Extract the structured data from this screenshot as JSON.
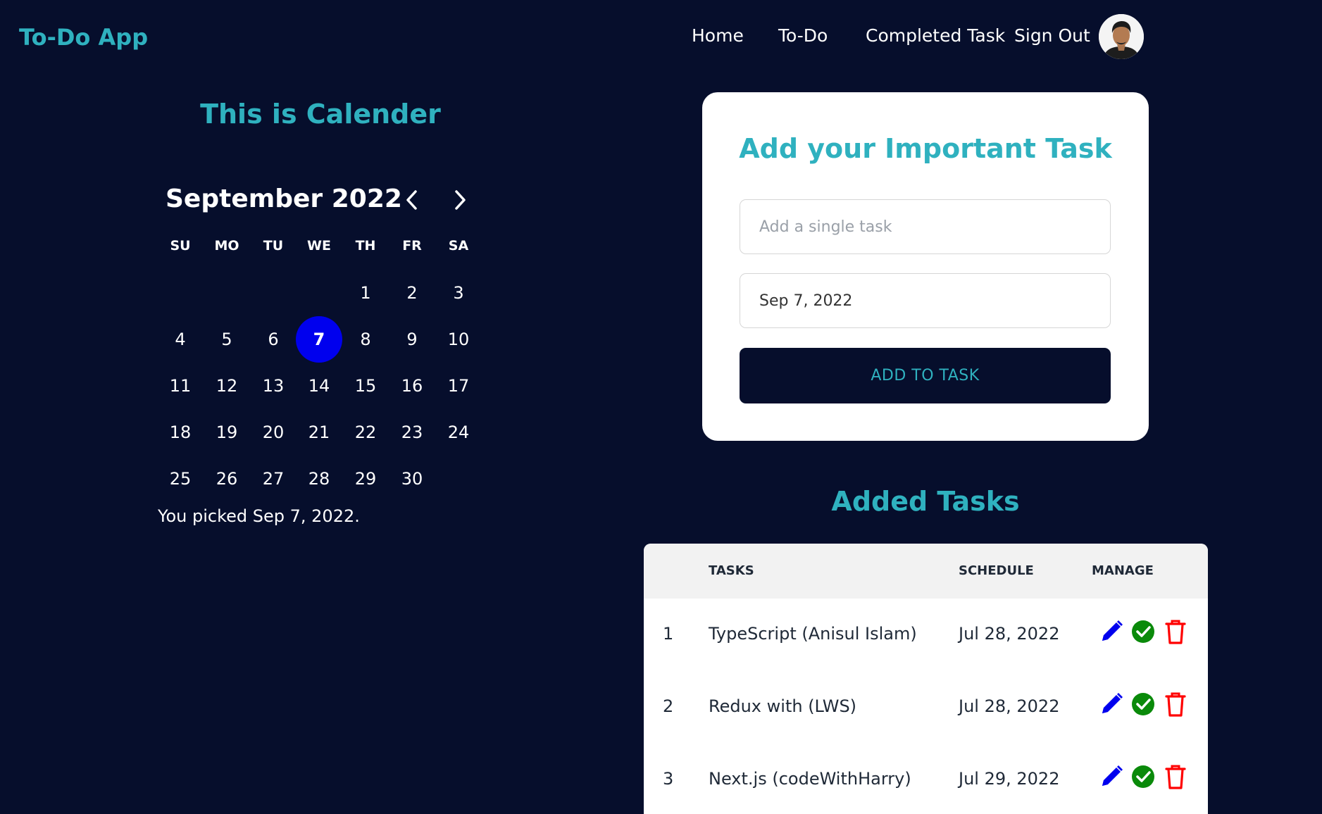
{
  "header": {
    "brand": "To-Do App",
    "nav": [
      "Home",
      "To-Do",
      "Completed Task",
      "Sign Out"
    ]
  },
  "calendar": {
    "heading": "This is Calender",
    "month": "September 2022",
    "weekdays": [
      "SU",
      "MO",
      "TU",
      "WE",
      "TH",
      "FR",
      "SA"
    ],
    "first_weekday_index": 4,
    "days_in_month": 30,
    "selected_day": 7,
    "picked_text": "You picked Sep 7, 2022."
  },
  "add_task": {
    "title": "Add your Important Task",
    "task_placeholder": "Add a single task",
    "date_value": "Sep 7, 2022",
    "button_label": "ADD TO TASK"
  },
  "tasks": {
    "heading": "Added Tasks",
    "columns": [
      "TASKS",
      "SCHEDULE",
      "MANAGE"
    ],
    "rows": [
      {
        "num": "1",
        "task": "TypeScript (Anisul Islam)",
        "schedule": "Jul 28, 2022"
      },
      {
        "num": "2",
        "task": "Redux with (LWS)",
        "schedule": "Jul 28, 2022"
      },
      {
        "num": "3",
        "task": "Next.js (codeWithHarry)",
        "schedule": "Jul 29, 2022"
      }
    ]
  },
  "colors": {
    "background": "#060e2c",
    "accent": "#2fb1bf",
    "selected_day": "#0000ee",
    "edit_icon": "#0000ee",
    "done_icon": "#0a8a0a",
    "delete_icon": "#ff0000"
  },
  "icons": {
    "prev": "chevron-left-icon",
    "next": "chevron-right-icon",
    "edit": "pencil-icon",
    "done": "check-circle-icon",
    "delete": "trash-icon"
  }
}
